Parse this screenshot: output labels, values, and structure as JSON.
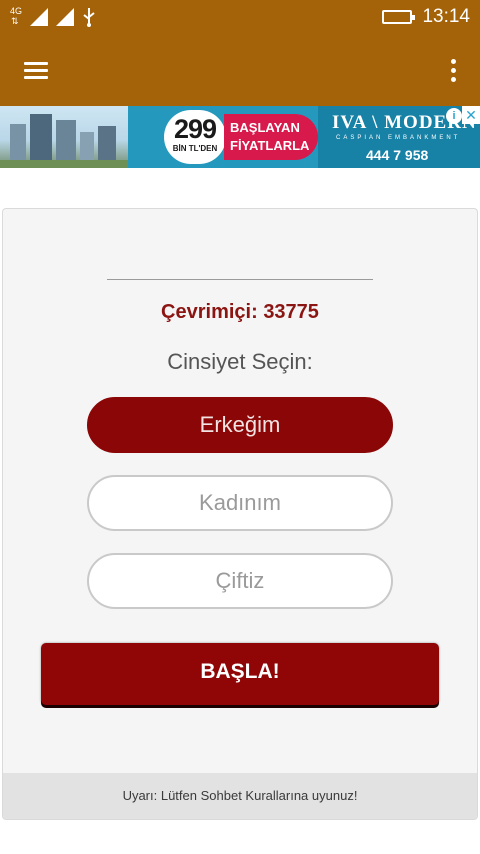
{
  "status_bar": {
    "network_type": "4G",
    "time": "13:14",
    "icons": [
      "signal-icon",
      "usb-icon",
      "battery-charging-icon"
    ]
  },
  "app_bar": {
    "menu_icon": "hamburger-menu-icon",
    "overflow_icon": "more-vert-icon",
    "background": "#a46308"
  },
  "ad": {
    "price": "299",
    "price_sub": "BİN TL'DEN",
    "headline_1": "BAŞLAYAN",
    "headline_2": "FİYATLARLA",
    "brand": "IVA \\ MODERN",
    "brand_sub": "CASPIAN  EMBANKMENT",
    "phone": "444 7 958",
    "adchoices_glyph": "i",
    "close_glyph": "✕"
  },
  "main": {
    "online_label": "Çevrimiçi: 33775",
    "gender_title": "Cinsiyet Seçin:",
    "gender_options": [
      {
        "label": "Erkeğim",
        "selected": true
      },
      {
        "label": "Kadınım",
        "selected": false
      },
      {
        "label": "Çiftiz",
        "selected": false
      }
    ],
    "start_label": "BAŞLA!",
    "warning": "Uyarı: Lütfen Sohbet Kurallarına uyunuz!"
  },
  "colors": {
    "accent": "#8b0606",
    "online_text": "#8b1512",
    "card_background": "#f5f5f5"
  }
}
